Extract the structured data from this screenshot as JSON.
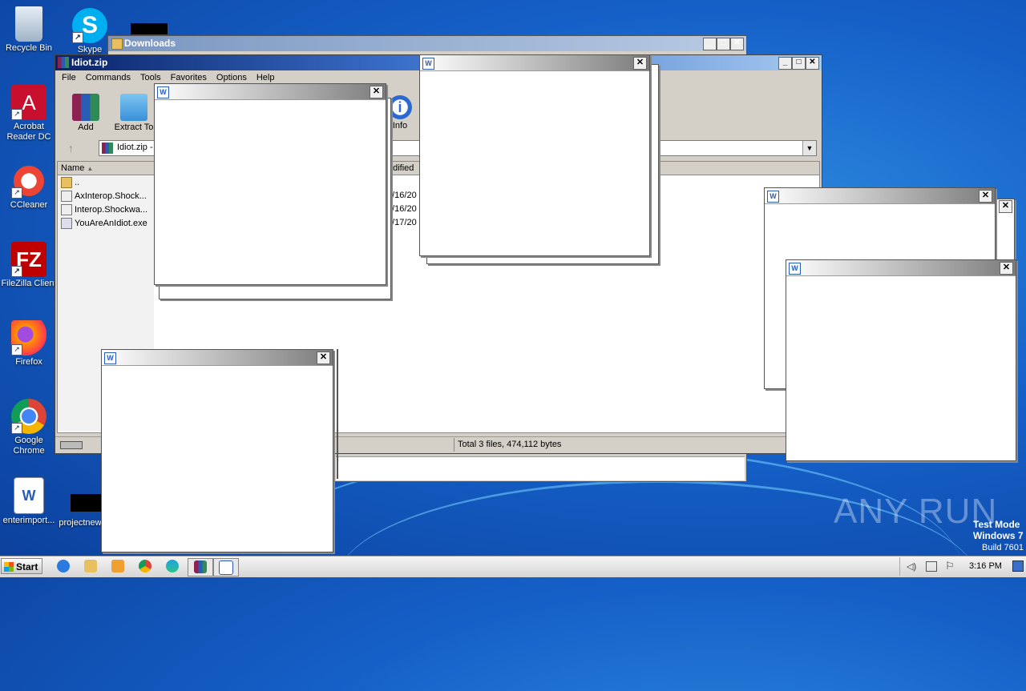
{
  "desktop": {
    "icons": [
      {
        "label": "Recycle Bin"
      },
      {
        "label": "Skype"
      },
      {
        "label": "Acrobat Reader DC"
      },
      {
        "label": "CCleaner"
      },
      {
        "label": "FileZilla Client"
      },
      {
        "label": "Firefox"
      },
      {
        "label": "Google Chrome"
      },
      {
        "label": "enterimport..."
      },
      {
        "label": "projectnew"
      }
    ]
  },
  "downloads_window": {
    "title": "Downloads"
  },
  "winrar": {
    "title": "Idiot.zip",
    "menu": [
      "File",
      "Commands",
      "Tools",
      "Favorites",
      "Options",
      "Help"
    ],
    "toolbar": {
      "add": "Add",
      "extract": "Extract To",
      "info": "Info"
    },
    "path": "Idiot.zip -",
    "columns": {
      "name": "Name",
      "modified": "odified"
    },
    "files": [
      {
        "name": "..",
        "date": ""
      },
      {
        "name": "AxInterop.Shock...",
        "date": "0/16/20"
      },
      {
        "name": "Interop.Shockwa...",
        "date": "0/16/20"
      },
      {
        "name": "YouAreAnIdiot.exe",
        "date": "0/17/20"
      }
    ],
    "status": "Total 3 files, 474,112 bytes"
  },
  "watermark": {
    "brand": "ANY RUN",
    "line1": "Test Mode",
    "line2": "Windows 7",
    "line3": "Build 7601"
  },
  "taskbar": {
    "start": "Start",
    "time": "3:16 PM"
  }
}
